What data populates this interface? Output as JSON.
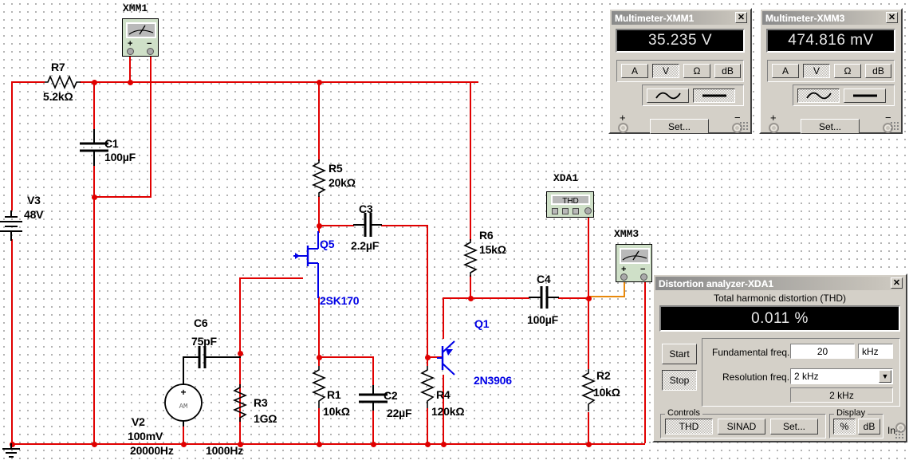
{
  "canvas": {
    "background_color": "#ffffff",
    "wire_color": "#e00000",
    "label_color": "#000000",
    "device_label_color": "#0000e6"
  },
  "components": [
    {
      "ref": "R7",
      "value": "5.2kΩ",
      "type": "resistor"
    },
    {
      "ref": "V3",
      "value": "48V",
      "type": "battery"
    },
    {
      "ref": "C1",
      "value": "100µF",
      "type": "capacitor"
    },
    {
      "ref": "R5",
      "value": "20kΩ",
      "type": "resistor"
    },
    {
      "ref": "C3",
      "value": "2.2µF",
      "type": "capacitor"
    },
    {
      "ref": "Q5",
      "value": "2SK170",
      "type": "jfet"
    },
    {
      "ref": "C6",
      "value": "75pF",
      "type": "capacitor"
    },
    {
      "ref": "V2",
      "value": "100mV",
      "freq1": "20000Hz",
      "freq2": "1000Hz",
      "type": "ac-source"
    },
    {
      "ref": "R3",
      "value": "1GΩ",
      "type": "resistor"
    },
    {
      "ref": "R1",
      "value": "10kΩ",
      "type": "resistor"
    },
    {
      "ref": "C2",
      "value": "22µF",
      "type": "capacitor"
    },
    {
      "ref": "R4",
      "value": "120kΩ",
      "type": "resistor"
    },
    {
      "ref": "R6",
      "value": "15kΩ",
      "type": "resistor"
    },
    {
      "ref": "Q1",
      "value": "2N3906",
      "type": "bjt-pnp"
    },
    {
      "ref": "C4",
      "value": "100µF",
      "type": "capacitor"
    },
    {
      "ref": "R2",
      "value": "10kΩ",
      "type": "resistor"
    }
  ],
  "instrument_icons": {
    "xmm1": {
      "label": "XMM1",
      "plus": "+",
      "minus": "−"
    },
    "xda1": {
      "label": "XDA1",
      "screen_text": "THD"
    },
    "xmm3": {
      "label": "XMM3",
      "plus": "+",
      "minus": "−"
    }
  },
  "multimeter1": {
    "title": "Multimeter-XMM1",
    "close_label": "✕",
    "reading": "35.235 V",
    "modes": [
      "A",
      "V",
      "Ω",
      "dB"
    ],
    "selected_mode": "V",
    "coupling": [
      "∿",
      "▬"
    ],
    "selected_coupling": "DC",
    "set_label": "Set...",
    "plus_label": "+",
    "minus_label": "−"
  },
  "multimeter3": {
    "title": "Multimeter-XMM3",
    "close_label": "✕",
    "reading": "474.816 mV",
    "modes": [
      "A",
      "V",
      "Ω",
      "dB"
    ],
    "selected_mode": "V",
    "coupling": [
      "∿",
      "▬"
    ],
    "selected_coupling": "AC",
    "set_label": "Set...",
    "plus_label": "+",
    "minus_label": "−"
  },
  "distortion_analyzer": {
    "title": "Distortion analyzer-XDA1",
    "close_label": "✕",
    "caption": "Total harmonic distortion (THD)",
    "reading": "0.011 %",
    "start_label": "Start",
    "stop_label": "Stop",
    "fundamental_label": "Fundamental freq.",
    "fundamental_value": "20",
    "fundamental_unit": "kHz",
    "resolution_label": "Resolution freq.",
    "resolution_value": "2 kHz",
    "resolution_readout": "2 kHz",
    "controls_group": "Controls",
    "controls": [
      "THD",
      "SINAD",
      "Set..."
    ],
    "selected_control": "THD",
    "display_group": "Display",
    "display_units": [
      "%",
      "dB"
    ],
    "selected_display": "%",
    "in_label": "In"
  }
}
